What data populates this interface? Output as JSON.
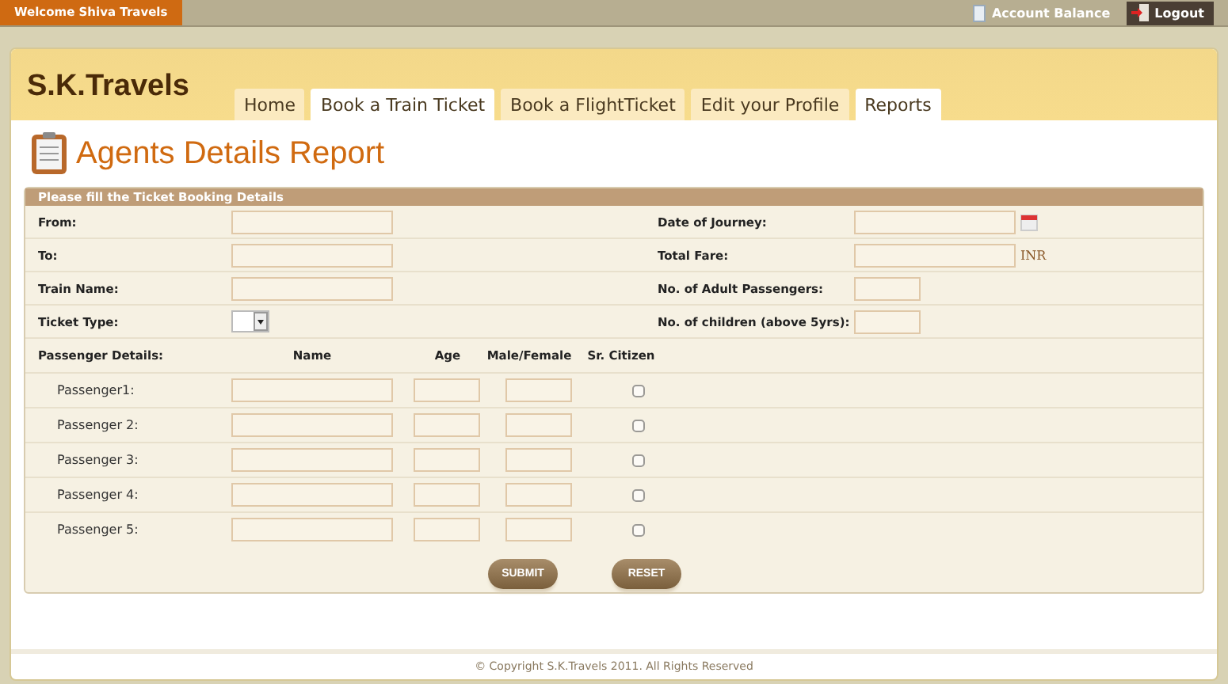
{
  "top_bar": {
    "welcome": "Welcome Shiva Travels",
    "account_balance": "Account Balance",
    "logout": "Logout"
  },
  "brand": "S.K.Travels",
  "tabs": [
    {
      "label": "Home",
      "selected": false
    },
    {
      "label": "Book a Train Ticket",
      "selected": true
    },
    {
      "label": "Book a FlightTicket",
      "selected": false
    },
    {
      "label": "Edit your Profile",
      "selected": false
    },
    {
      "label": "Reports",
      "selected": true
    }
  ],
  "page_title": "Agents Details Report",
  "form": {
    "heading": "Please fill the Ticket Booking Details",
    "rows": [
      {
        "left": {
          "label": "From:",
          "kind": "text"
        },
        "right": {
          "label": "Date of Journey:",
          "kind": "date"
        }
      },
      {
        "left": {
          "label": "To:",
          "kind": "text"
        },
        "right": {
          "label": "Total Fare:",
          "kind": "currency",
          "suffix": "INR"
        }
      },
      {
        "left": {
          "label": "Train Name:",
          "kind": "text"
        },
        "right": {
          "label": "No. of Adult Passengers:",
          "kind": "short"
        }
      },
      {
        "left": {
          "label": "Ticket Type:",
          "kind": "select"
        },
        "right": {
          "label": "No. of children (above 5yrs):",
          "kind": "short"
        }
      }
    ],
    "passenger_label": "Passenger Details:",
    "columns": [
      "Name",
      "Age",
      "Male/Female",
      "Sr. Citizen"
    ],
    "passengers": [
      {
        "label": "Passenger1:",
        "senior": false
      },
      {
        "label": "Passenger 2:",
        "senior": false
      },
      {
        "label": "Passenger 3:",
        "senior": false
      },
      {
        "label": "Passenger 4:",
        "senior": false
      },
      {
        "label": "Passenger 5:",
        "senior": false
      }
    ],
    "buttons": [
      "SUBMIT",
      "RESET"
    ]
  },
  "footer": "© Copyright S.K.Travels 2011. All Rights Reserved"
}
